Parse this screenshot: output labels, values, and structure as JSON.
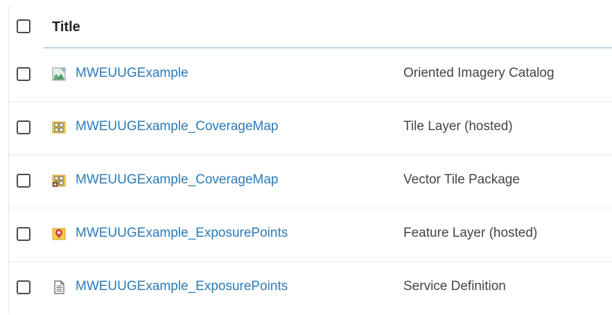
{
  "header": {
    "title": "Title"
  },
  "rows": [
    {
      "title": "MWEUUGExample",
      "type": "Oriented Imagery Catalog",
      "icon": "oriented-imagery-icon"
    },
    {
      "title": "MWEUUGExample_CoverageMap",
      "type": "Tile Layer (hosted)",
      "icon": "tile-layer-icon"
    },
    {
      "title": "MWEUUGExample_CoverageMap",
      "type": "Vector Tile Package",
      "icon": "vector-tile-package-icon"
    },
    {
      "title": "MWEUUGExample_ExposurePoints",
      "type": "Feature Layer (hosted)",
      "icon": "feature-layer-icon"
    },
    {
      "title": "MWEUUGExample_ExposurePoints",
      "type": "Service Definition",
      "icon": "service-definition-icon"
    }
  ],
  "colors": {
    "link": "#2b7ab8",
    "header_rule": "#bcd3e6"
  }
}
